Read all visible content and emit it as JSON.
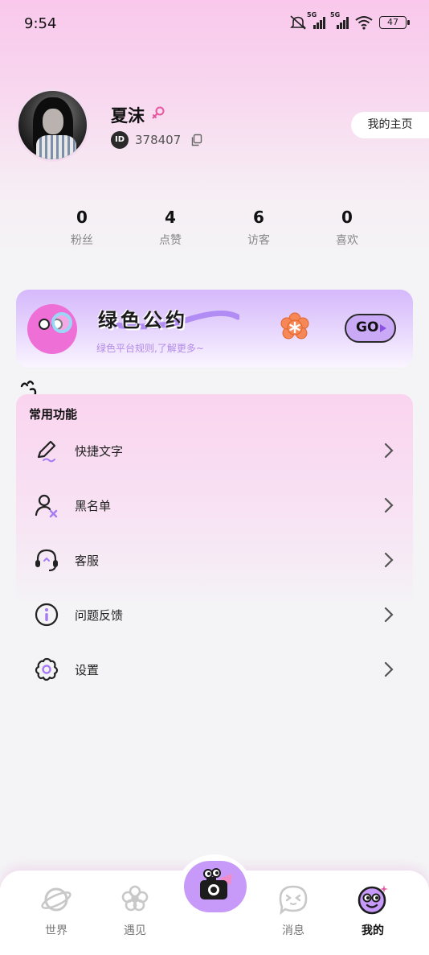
{
  "status_bar": {
    "time": "9:54",
    "net1": "5G",
    "net2": "5G",
    "battery": "47"
  },
  "profile": {
    "username": "夏沫",
    "id_label": "ID",
    "user_id": "378407",
    "home_button": "我的主页"
  },
  "stats": [
    {
      "value": "0",
      "label": "粉丝"
    },
    {
      "value": "4",
      "label": "点赞"
    },
    {
      "value": "6",
      "label": "访客"
    },
    {
      "value": "0",
      "label": "喜欢"
    }
  ],
  "banner": {
    "title": "绿色公约",
    "subtitle": "绿色平台规则,了解更多~",
    "go_label": "GO"
  },
  "functions": {
    "title": "常用功能",
    "items": [
      {
        "label": "快捷文字",
        "icon": "pen-icon"
      },
      {
        "label": "黑名单",
        "icon": "user-block-icon"
      },
      {
        "label": "客服",
        "icon": "headset-icon"
      },
      {
        "label": "问题反馈",
        "icon": "info-icon"
      },
      {
        "label": "设置",
        "icon": "settings-icon"
      }
    ]
  },
  "nav": {
    "items": [
      {
        "label": "世界",
        "icon": "planet-icon"
      },
      {
        "label": "遇见",
        "icon": "flower-icon"
      },
      {
        "label": "",
        "icon": "camera-icon"
      },
      {
        "label": "消息",
        "icon": "message-face-icon"
      },
      {
        "label": "我的",
        "icon": "smiley-face-icon"
      }
    ],
    "active": "我的"
  },
  "colors": {
    "accent": "#c79af9",
    "female": "#e8559f",
    "banner_sub": "#b38be8"
  }
}
